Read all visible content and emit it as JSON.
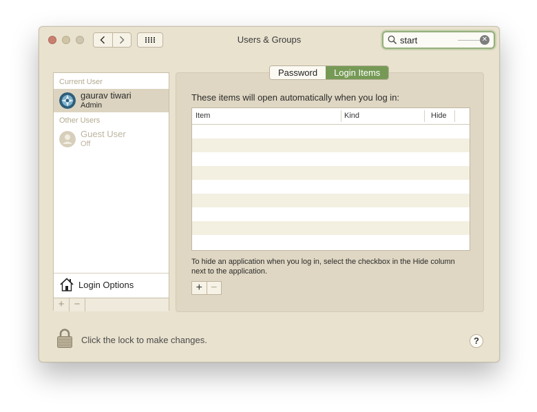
{
  "window": {
    "title": "Users & Groups"
  },
  "search": {
    "value": "start"
  },
  "sidebar": {
    "current_user_label": "Current User",
    "other_users_label": "Other Users",
    "users": [
      {
        "name": "gaurav tiwari",
        "role": "Admin",
        "selected": true
      },
      {
        "name": "Guest User",
        "role": "Off",
        "selected": false
      }
    ],
    "login_options_label": "Login Options",
    "add_symbol": "+",
    "remove_symbol": "−"
  },
  "tabs": [
    {
      "label": "Password",
      "active": false
    },
    {
      "label": "Login Items",
      "active": true
    }
  ],
  "login_items": {
    "info": "These items will open automatically when you log in:",
    "columns": [
      "Item",
      "Kind",
      "Hide"
    ],
    "rows": [],
    "hint": "To hide an application when you log in, select the checkbox in the Hide column next to the application.",
    "add_symbol": "+",
    "remove_symbol": "−"
  },
  "footer": {
    "lock_text": "Click the lock to make changes.",
    "help_symbol": "?"
  },
  "colors": {
    "window_bg": "#e9e2cf",
    "accent_tab": "#769a56",
    "search_focus": "#94b07b",
    "selected_row": "#dcd4c0"
  }
}
